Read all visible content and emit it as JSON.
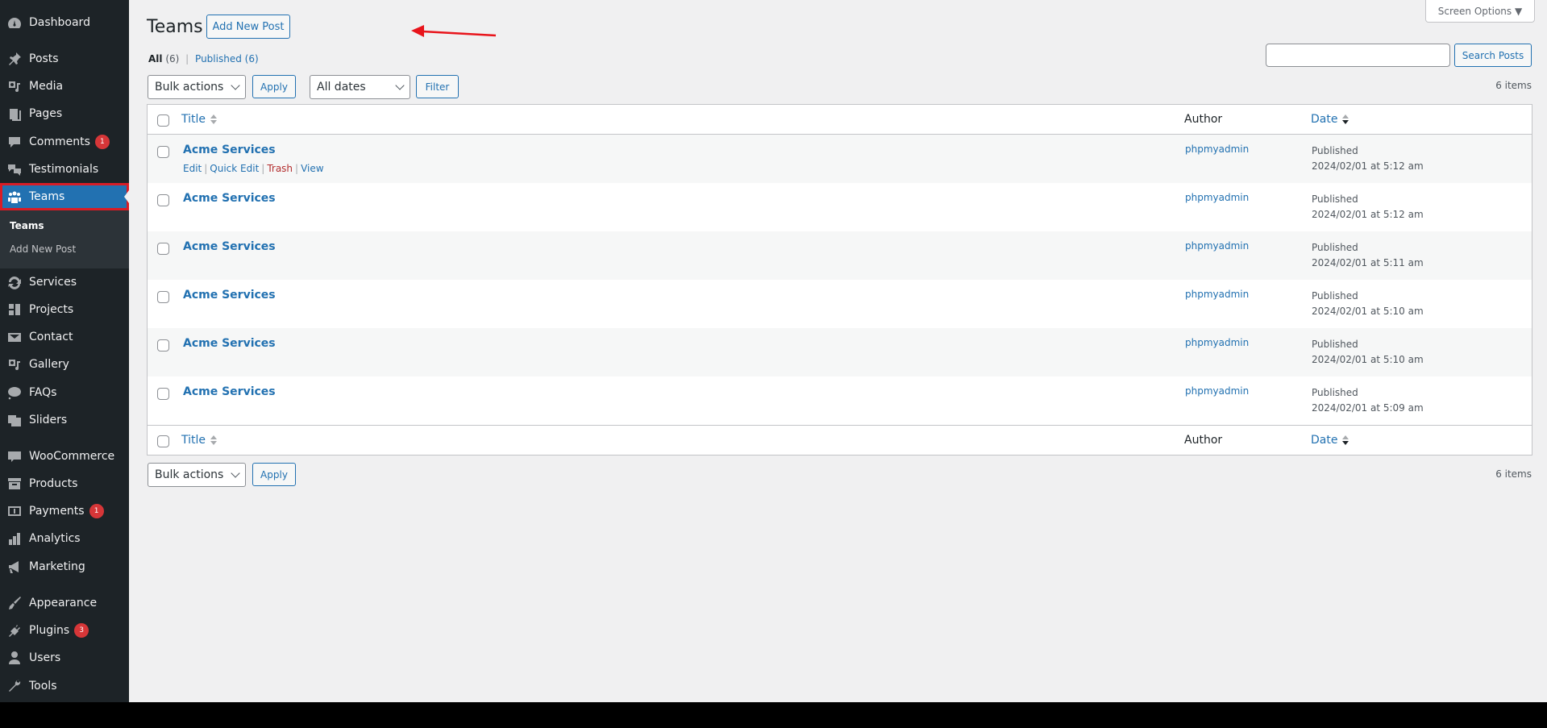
{
  "sidebar": {
    "items": [
      {
        "label": "Dashboard",
        "icon": "dashboard-icon"
      },
      {
        "label": "Posts",
        "icon": "pin-icon"
      },
      {
        "label": "Media",
        "icon": "media-icon"
      },
      {
        "label": "Pages",
        "icon": "pages-icon"
      },
      {
        "label": "Comments",
        "icon": "comment-icon",
        "badge": "1"
      },
      {
        "label": "Testimonials",
        "icon": "testimonial-icon"
      },
      {
        "label": "Teams",
        "icon": "groups-icon",
        "active": true
      },
      {
        "label": "Services",
        "icon": "update-icon"
      },
      {
        "label": "Projects",
        "icon": "portfolio-icon"
      },
      {
        "label": "Contact",
        "icon": "email-icon"
      },
      {
        "label": "Gallery",
        "icon": "media-icon"
      },
      {
        "label": "FAQs",
        "icon": "chat-icon"
      },
      {
        "label": "Sliders",
        "icon": "slides-icon"
      },
      {
        "label": "WooCommerce",
        "icon": "woo-icon"
      },
      {
        "label": "Products",
        "icon": "archive-icon"
      },
      {
        "label": "Payments",
        "icon": "money-icon",
        "badge": "1"
      },
      {
        "label": "Analytics",
        "icon": "chart-bar-icon"
      },
      {
        "label": "Marketing",
        "icon": "megaphone-icon"
      },
      {
        "label": "Appearance",
        "icon": "brush-icon"
      },
      {
        "label": "Plugins",
        "icon": "plugin-icon",
        "badge": "3"
      },
      {
        "label": "Users",
        "icon": "user-icon"
      },
      {
        "label": "Tools",
        "icon": "wrench-icon"
      }
    ],
    "submenu": [
      {
        "label": "Teams",
        "current": true
      },
      {
        "label": "Add New Post"
      }
    ]
  },
  "header": {
    "title": "Teams",
    "add_new_label": "Add New Post",
    "screen_options_label": "Screen Options ▼"
  },
  "views": {
    "all_label": "All",
    "all_count": "(6)",
    "published_label": "Published",
    "published_count": "(6)"
  },
  "search": {
    "value": "",
    "button_label": "Search Posts"
  },
  "filters": {
    "bulk_actions": "Bulk actions",
    "apply_label": "Apply",
    "dates": "All dates",
    "filter_label": "Filter",
    "items_count": "6 items"
  },
  "table": {
    "columns": {
      "title": "Title",
      "author": "Author",
      "date": "Date"
    },
    "row_actions": {
      "edit": "Edit",
      "quick_edit": "Quick Edit",
      "trash": "Trash",
      "view": "View"
    },
    "rows": [
      {
        "title": "Acme Services",
        "author": "phpmyadmin",
        "status": "Published",
        "date": "2024/02/01 at 5:12 am"
      },
      {
        "title": "Acme Services",
        "author": "phpmyadmin",
        "status": "Published",
        "date": "2024/02/01 at 5:12 am"
      },
      {
        "title": "Acme Services",
        "author": "phpmyadmin",
        "status": "Published",
        "date": "2024/02/01 at 5:11 am"
      },
      {
        "title": "Acme Services",
        "author": "phpmyadmin",
        "status": "Published",
        "date": "2024/02/01 at 5:10 am"
      },
      {
        "title": "Acme Services",
        "author": "phpmyadmin",
        "status": "Published",
        "date": "2024/02/01 at 5:10 am"
      },
      {
        "title": "Acme Services",
        "author": "phpmyadmin",
        "status": "Published",
        "date": "2024/02/01 at 5:09 am"
      }
    ]
  },
  "colors": {
    "accent": "#2271b1",
    "sidebar_bg": "#1d2327",
    "badge": "#d63638",
    "annotation": "#e8141b"
  }
}
